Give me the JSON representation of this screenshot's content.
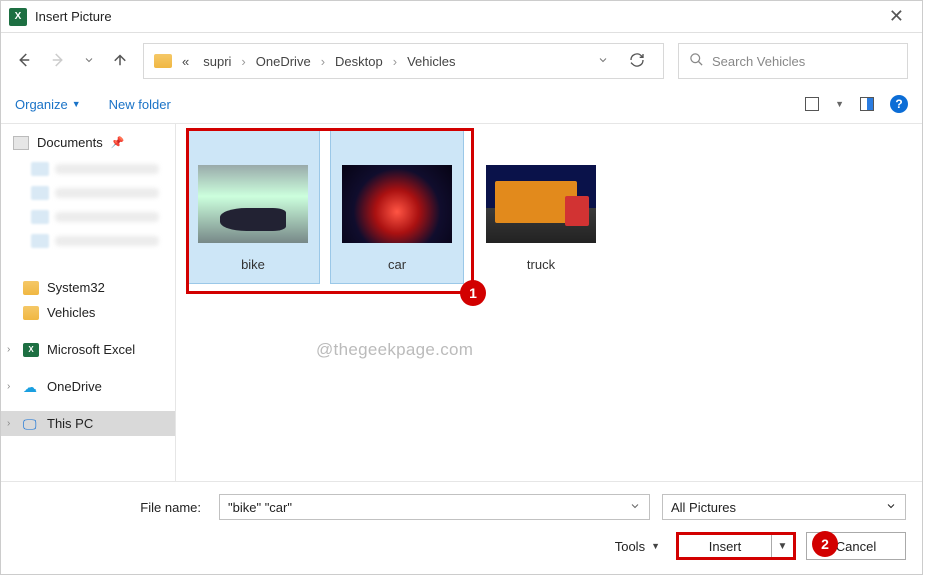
{
  "window": {
    "title": "Insert Picture"
  },
  "breadcrumb": {
    "prefix": "«",
    "segments": [
      "supri",
      "OneDrive",
      "Desktop",
      "Vehicles"
    ]
  },
  "search": {
    "placeholder": "Search Vehicles"
  },
  "toolbar": {
    "organize": "Organize",
    "new_folder": "New folder",
    "help_char": "?"
  },
  "sidebar": {
    "documents": "Documents",
    "system32": "System32",
    "vehicles": "Vehicles",
    "excel": "Microsoft Excel",
    "onedrive": "OneDrive",
    "this_pc": "This PC"
  },
  "files": [
    {
      "name": "bike",
      "selected": true
    },
    {
      "name": "car",
      "selected": true
    },
    {
      "name": "truck",
      "selected": false
    }
  ],
  "watermark": "@thegeekpage.com",
  "bottom": {
    "file_name_label": "File name:",
    "file_name_value": "\"bike\" \"car\"",
    "filter": "All Pictures",
    "tools": "Tools",
    "insert": "Insert",
    "cancel": "Cancel"
  },
  "annotations": {
    "badge1": "1",
    "badge2": "2"
  }
}
